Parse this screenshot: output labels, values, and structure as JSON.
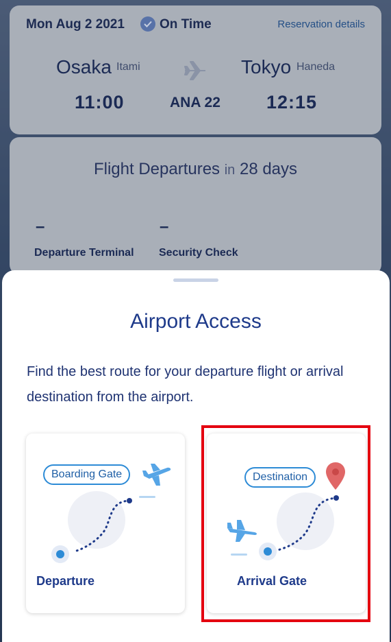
{
  "flight_card": {
    "date": "Mon Aug 2 2021",
    "status": "On Time",
    "reservation_link": "Reservation details",
    "origin_city": "Osaka",
    "origin_airport": "Itami",
    "dest_city": "Tokyo",
    "dest_airport": "Haneda",
    "dep_time": "11:00",
    "flight_number": "ANA 22",
    "arr_time": "12:15"
  },
  "departure_card": {
    "title_prefix": "Flight Departures",
    "title_in": "in",
    "title_days": "28 days",
    "terminal_value": "–",
    "terminal_label": "Departure Terminal",
    "security_value": "–",
    "security_label": "Security Check"
  },
  "sheet": {
    "title": "Airport Access",
    "description": "Find the best route for your departure flight or arrival destination from the airport.",
    "options": [
      {
        "pill": "Boarding Gate",
        "label": "Departure"
      },
      {
        "pill": "Destination",
        "label": "Arrival Gate"
      }
    ]
  },
  "colors": {
    "brand_blue": "#1e3a8a",
    "accent_blue": "#2d8bd6",
    "pin_red": "#e06767",
    "highlight_red": "#e4000f"
  }
}
